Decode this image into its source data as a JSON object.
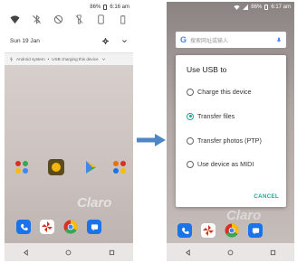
{
  "colors": {
    "accent": "#19a89c",
    "arrow": "#4f86c6"
  },
  "left_screen": {
    "status": {
      "battery": "86%",
      "time": "6:16 am"
    },
    "quick_settings": [
      "wifi-icon",
      "bluetooth-off-icon",
      "do-not-disturb-icon",
      "flashlight-off-icon",
      "rotate-icon",
      "battery-saver-icon"
    ],
    "date": "Sun 19 Jan",
    "notification": {
      "source": "Android system",
      "separator": "•",
      "text": "USB charging this device",
      "chevron": "chevron-down-icon"
    },
    "watermark": "Claro",
    "dock": [
      "phone-app-icon",
      "pinwheel-app-icon",
      "chrome-app-icon",
      "messages-app-icon"
    ],
    "nav": [
      "back-icon",
      "home-icon",
      "recents-icon"
    ]
  },
  "right_screen": {
    "status": {
      "battery": "86%",
      "time": "6:17 am"
    },
    "search_hint": "搜索网址或输入",
    "dialog": {
      "title": "Use USB to",
      "options": [
        {
          "label": "Charge this device",
          "selected": false
        },
        {
          "label": "Transfer files",
          "selected": true
        },
        {
          "label": "Transfer photos (PTP)",
          "selected": false
        },
        {
          "label": "Use device as MIDI",
          "selected": false
        }
      ],
      "cancel": "CANCEL"
    },
    "watermark": "Claro",
    "nav": [
      "back-icon",
      "home-icon",
      "recents-icon"
    ]
  }
}
